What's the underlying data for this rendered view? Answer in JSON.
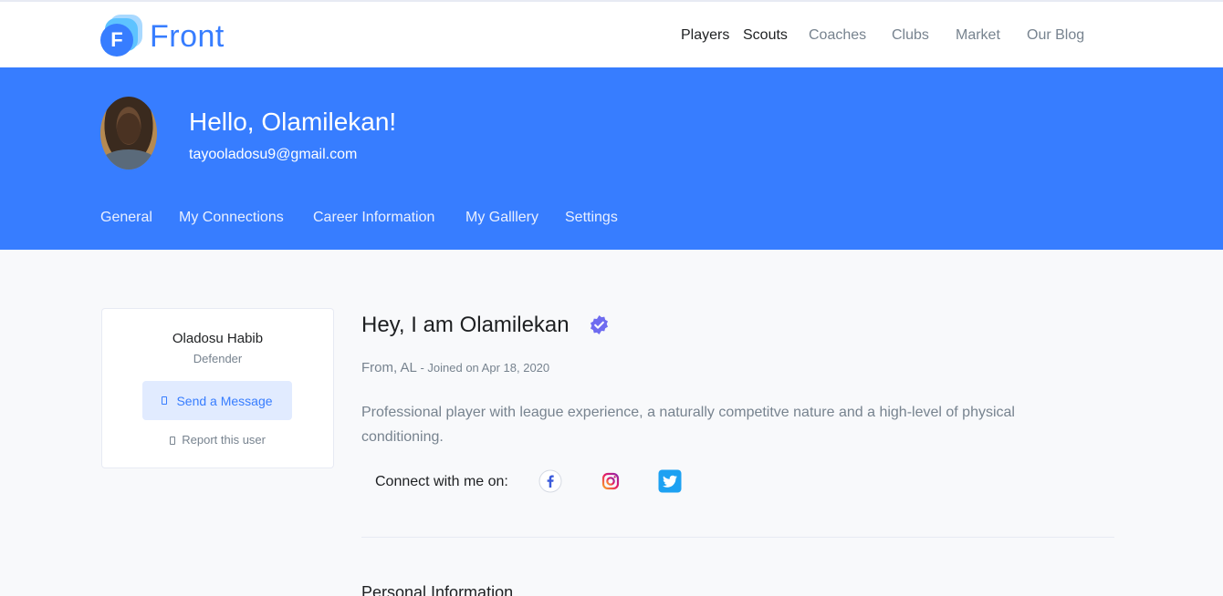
{
  "brand": {
    "name": "Front",
    "logo_letter": "F",
    "color": "#377dff"
  },
  "nav": [
    "Players",
    "Scouts",
    "Coaches",
    "Clubs",
    "Market",
    "Our Blog"
  ],
  "hero": {
    "greeting": "Hello, Olamilekan!",
    "email": "tayooladosu9@gmail.com",
    "tabs": [
      "General",
      "My Connections",
      "Career Information",
      "My Galllery",
      "Settings"
    ]
  },
  "profile_card": {
    "name": "Oladosu Habib",
    "role": "Defender",
    "message_button": "Send a Message",
    "report_link": "Report this user"
  },
  "main": {
    "headline": "Hey, I am Olamilekan",
    "from": "From, AL",
    "joined": "- Joined on Apr 18, 2020",
    "bio": "Professional player with league experience, a naturally competitve nature and a high-level of physical conditioning.",
    "connect_label": "Connect with me on:",
    "social_icons": [
      "facebook-icon",
      "instagram-icon",
      "twitter-icon"
    ],
    "next_section": "Personal Information"
  }
}
